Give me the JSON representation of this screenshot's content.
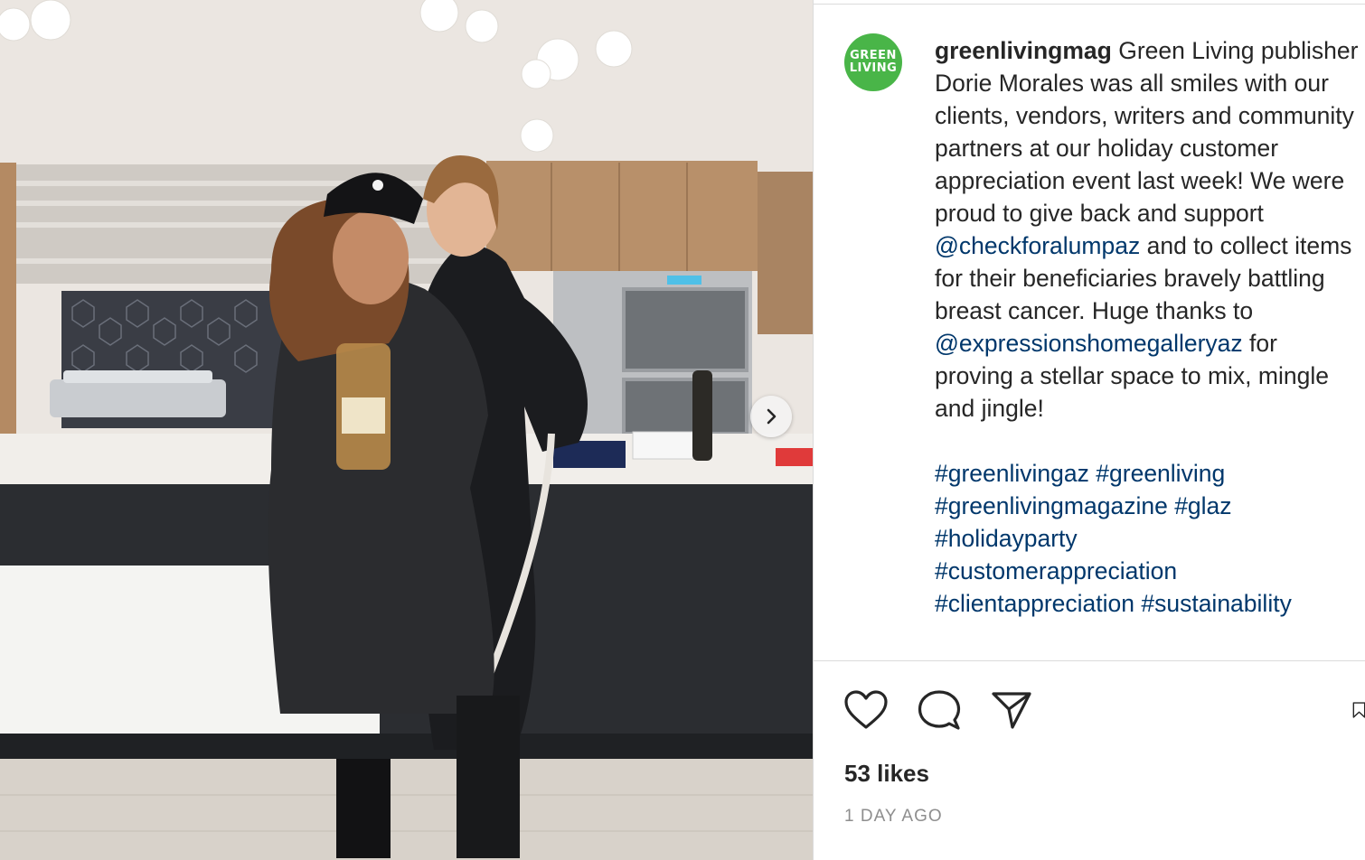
{
  "post": {
    "username": "greenlivingmag",
    "avatar_text_line1": "GREEN",
    "avatar_text_line2": "LIVING",
    "caption_part1": "Green Living publisher Dorie Morales was all smiles with our clients, vendors, writers and community partners at our holiday customer appreciation event last week! We were proud to give back and support",
    "mention1": "@checkforalumpaz",
    "caption_part2": "and to collect items for their beneficiaries bravely battling breast cancer. Huge thanks to",
    "mention2": "@expressionshomegalleryaz",
    "caption_part3": "for proving a stellar space to mix, mingle and jingle!",
    "hashtags": [
      "#greenlivingaz",
      "#greenliving",
      "#greenlivingmagazine",
      "#glaz",
      "#holidayparty",
      "#customerappreciation",
      "#clientappreciation",
      "#sustainability"
    ],
    "likes": "53 likes",
    "timestamp": "1 DAY AGO"
  },
  "icons": {
    "like": "heart-icon",
    "comment": "comment-icon",
    "share": "share-icon",
    "save": "bookmark-icon",
    "next": "chevron-right-icon"
  },
  "colors": {
    "brand_green": "#49b548",
    "link_blue": "#00376b",
    "text": "#262626",
    "muted": "#8e8e8e"
  }
}
